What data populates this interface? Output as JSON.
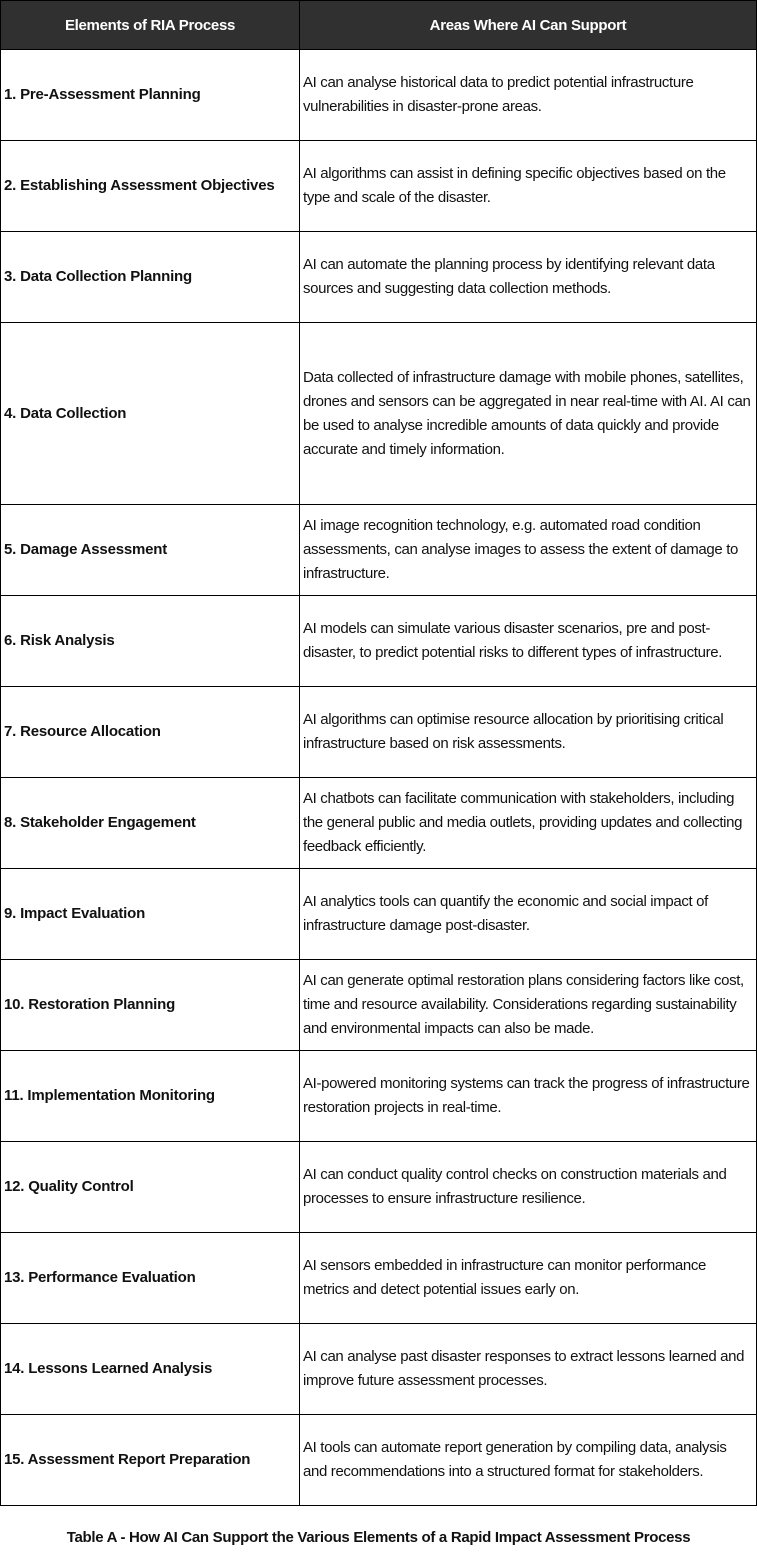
{
  "table": {
    "headers": [
      "Elements of RIA Process",
      "Areas Where AI Can Support"
    ],
    "header_bg": "#303030",
    "rows": [
      {
        "element": "1. Pre-Assessment Planning",
        "support": "AI can analyse historical data to predict potential infrastructure vulnerabilities in disaster-prone areas."
      },
      {
        "element": "2. Establishing Assessment Objectives",
        "support": "AI algorithms can assist in defining specific objectives based on the type and scale of the disaster."
      },
      {
        "element": "3. Data Collection Planning",
        "support": "AI can automate the planning process by identifying relevant data sources and suggesting data collection methods."
      },
      {
        "element": "4. Data Collection",
        "support": "Data collected of infrastructure damage with mobile phones, satellites, drones and sensors can be aggregated in near real-time with AI. AI can be used to analyse incredible amounts of data quickly and provide accurate and timely information."
      },
      {
        "element": "5. Damage Assessment",
        "support": "AI image recognition technology, e.g. automated road condition assessments, can analyse images to assess the extent of damage to infrastructure."
      },
      {
        "element": "6. Risk Analysis",
        "support": "AI models can simulate various disaster scenarios, pre and post-disaster, to predict potential risks to different types of infrastructure."
      },
      {
        "element": "7. Resource Allocation",
        "support": "AI algorithms can optimise resource allocation by prioritising critical infrastructure based on risk assessments."
      },
      {
        "element": "8. Stakeholder Engagement",
        "support": "AI chatbots can facilitate communication with stakeholders, including the general public and media outlets, providing updates and collecting feedback efficiently."
      },
      {
        "element": "9. Impact Evaluation",
        "support": "AI analytics tools can quantify the economic and social impact of infrastructure damage post-disaster."
      },
      {
        "element": "10. Restoration Planning",
        "support": "AI can generate optimal restoration plans considering factors like cost, time and resource availability. Considerations regarding sustainability and environmental impacts can also be made."
      },
      {
        "element": "11. Implementation Monitoring",
        "support": "AI-powered monitoring systems can track the progress of infrastructure restoration projects in real-time."
      },
      {
        "element": "12. Quality Control",
        "support": "AI can conduct quality control checks on construction materials and processes to ensure infrastructure resilience."
      },
      {
        "element": "13. Performance Evaluation",
        "support": "AI sensors embedded in infrastructure can monitor performance metrics and detect potential issues early on."
      },
      {
        "element": "14. Lessons Learned Analysis",
        "support": "AI can analyse past disaster responses to extract lessons learned and improve future assessment processes."
      },
      {
        "element": "15. Assessment Report Preparation",
        "support": "AI tools can automate report generation by compiling data, analysis and recommendations into a structured format for stakeholders."
      }
    ]
  },
  "caption": "Table A - How AI Can Support the Various Elements of a Rapid Impact Assessment Process"
}
